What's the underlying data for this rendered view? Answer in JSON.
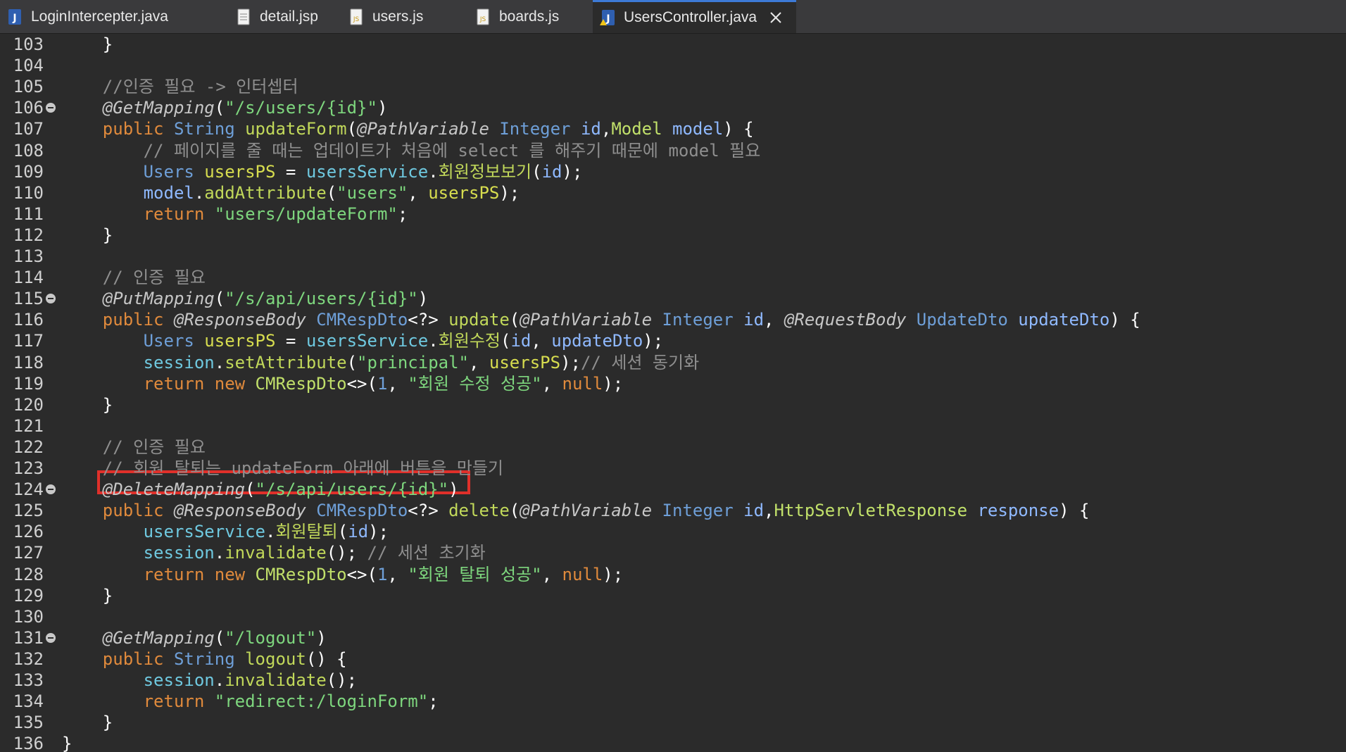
{
  "tabs": [
    {
      "label": "LoginIntercepter.java",
      "icon": "java-file-icon",
      "active": false
    },
    {
      "label": "detail.jsp",
      "icon": "jsp-file-icon",
      "active": false
    },
    {
      "label": "users.js",
      "icon": "js-file-icon",
      "active": false
    },
    {
      "label": "boards.js",
      "icon": "js-file-icon",
      "active": false
    },
    {
      "label": "UsersController.java",
      "icon": "java-file-warning-icon",
      "active": true
    }
  ],
  "colors": {
    "highlight_box": "#e0302a",
    "active_tab_accent": "#3d7ad6",
    "editor_bg": "#2b2b2b"
  },
  "editor": {
    "lines": [
      {
        "n": "103",
        "fold": false,
        "tokens": [
          [
            "plain",
            "    }"
          ]
        ]
      },
      {
        "n": "104",
        "fold": false,
        "tokens": []
      },
      {
        "n": "105",
        "fold": false,
        "tokens": [
          [
            "cm",
            "    //인증 필요 -> 인터셉터"
          ]
        ]
      },
      {
        "n": "106",
        "fold": true,
        "tokens": [
          [
            "ann",
            "    @GetMapping"
          ],
          [
            "plain",
            "("
          ],
          [
            "str",
            "\"/s/users/{id}\""
          ],
          [
            "plain",
            ")"
          ]
        ]
      },
      {
        "n": "107",
        "fold": false,
        "tokens": [
          [
            "kw",
            "    public "
          ],
          [
            "ty",
            "String "
          ],
          [
            "fn",
            "updateForm"
          ],
          [
            "plain",
            "("
          ],
          [
            "ann",
            "@PathVariable "
          ],
          [
            "ty",
            "Integer "
          ],
          [
            "par",
            "id"
          ],
          [
            "plain",
            ","
          ],
          [
            "cls",
            "Model "
          ],
          [
            "par",
            "model"
          ],
          [
            "plain",
            ") {"
          ]
        ]
      },
      {
        "n": "108",
        "fold": false,
        "tokens": [
          [
            "cm",
            "        // 페이지를 줄 때는 업데이트가 처음에 select 를 해주기 때문에 model 필요"
          ]
        ]
      },
      {
        "n": "109",
        "fold": false,
        "tokens": [
          [
            "ty",
            "        Users "
          ],
          [
            "var",
            "usersPS"
          ],
          [
            "plain",
            " = "
          ],
          [
            "fld",
            "usersService"
          ],
          [
            "plain",
            "."
          ],
          [
            "fn",
            "회원정보보기"
          ],
          [
            "plain",
            "("
          ],
          [
            "par",
            "id"
          ],
          [
            "plain",
            ");"
          ]
        ]
      },
      {
        "n": "110",
        "fold": false,
        "tokens": [
          [
            "par",
            "        model"
          ],
          [
            "plain",
            "."
          ],
          [
            "fn",
            "addAttribute"
          ],
          [
            "plain",
            "("
          ],
          [
            "str",
            "\"users\""
          ],
          [
            "plain",
            ", "
          ],
          [
            "var",
            "usersPS"
          ],
          [
            "plain",
            ");"
          ]
        ]
      },
      {
        "n": "111",
        "fold": false,
        "tokens": [
          [
            "kw",
            "        return "
          ],
          [
            "str",
            "\"users/updateForm\""
          ],
          [
            "plain",
            ";"
          ]
        ]
      },
      {
        "n": "112",
        "fold": false,
        "tokens": [
          [
            "plain",
            "    }"
          ]
        ]
      },
      {
        "n": "113",
        "fold": false,
        "tokens": []
      },
      {
        "n": "114",
        "fold": false,
        "tokens": [
          [
            "cm",
            "    // 인증 필요"
          ]
        ]
      },
      {
        "n": "115",
        "fold": true,
        "tokens": [
          [
            "ann",
            "    @PutMapping"
          ],
          [
            "plain",
            "("
          ],
          [
            "str",
            "\"/s/api/users/{id}\""
          ],
          [
            "plain",
            ")"
          ]
        ]
      },
      {
        "n": "116",
        "fold": false,
        "tokens": [
          [
            "kw",
            "    public "
          ],
          [
            "ann",
            "@ResponseBody "
          ],
          [
            "ty",
            "CMRespDto"
          ],
          [
            "plain",
            "<?> "
          ],
          [
            "fn",
            "update"
          ],
          [
            "plain",
            "("
          ],
          [
            "ann",
            "@PathVariable "
          ],
          [
            "ty",
            "Integer "
          ],
          [
            "par",
            "id"
          ],
          [
            "plain",
            ", "
          ],
          [
            "ann",
            "@RequestBody "
          ],
          [
            "ty",
            "UpdateDto "
          ],
          [
            "par",
            "updateDto"
          ],
          [
            "plain",
            ") {"
          ]
        ]
      },
      {
        "n": "117",
        "fold": false,
        "tokens": [
          [
            "ty",
            "        Users "
          ],
          [
            "var",
            "usersPS"
          ],
          [
            "plain",
            " = "
          ],
          [
            "fld",
            "usersService"
          ],
          [
            "plain",
            "."
          ],
          [
            "fn",
            "회원수정"
          ],
          [
            "plain",
            "("
          ],
          [
            "par",
            "id"
          ],
          [
            "plain",
            ", "
          ],
          [
            "par",
            "updateDto"
          ],
          [
            "plain",
            ");"
          ]
        ]
      },
      {
        "n": "118",
        "fold": false,
        "tokens": [
          [
            "fld",
            "        session"
          ],
          [
            "plain",
            "."
          ],
          [
            "fn",
            "setAttribute"
          ],
          [
            "plain",
            "("
          ],
          [
            "str",
            "\"principal\""
          ],
          [
            "plain",
            ", "
          ],
          [
            "var",
            "usersPS"
          ],
          [
            "plain",
            ");"
          ],
          [
            "cm",
            "// 세션 동기화"
          ]
        ]
      },
      {
        "n": "119",
        "fold": false,
        "tokens": [
          [
            "kw",
            "        return new "
          ],
          [
            "cls",
            "CMRespDto"
          ],
          [
            "plain",
            "<>("
          ],
          [
            "num",
            "1"
          ],
          [
            "plain",
            ", "
          ],
          [
            "str",
            "\"회원 수정 성공\""
          ],
          [
            "plain",
            ", "
          ],
          [
            "kw",
            "null"
          ],
          [
            "plain",
            ");"
          ]
        ]
      },
      {
        "n": "120",
        "fold": false,
        "tokens": [
          [
            "plain",
            "    }"
          ]
        ]
      },
      {
        "n": "121",
        "fold": false,
        "tokens": []
      },
      {
        "n": "122",
        "fold": false,
        "tokens": [
          [
            "cm",
            "    // 인증 필요"
          ]
        ]
      },
      {
        "n": "123",
        "fold": false,
        "tokens": [
          [
            "cm",
            "    // 회원 탈퇴는 updateForm 아래에 버튼을 만들기"
          ]
        ]
      },
      {
        "n": "124",
        "fold": true,
        "tokens": [
          [
            "ann",
            "    @DeleteMapping"
          ],
          [
            "plain",
            "("
          ],
          [
            "str",
            "\"/s/api/users/{id}\""
          ],
          [
            "plain",
            ")"
          ]
        ]
      },
      {
        "n": "125",
        "fold": false,
        "tokens": [
          [
            "kw",
            "    public "
          ],
          [
            "ann",
            "@ResponseBody "
          ],
          [
            "ty",
            "CMRespDto"
          ],
          [
            "plain",
            "<?> "
          ],
          [
            "fn",
            "delete"
          ],
          [
            "plain",
            "("
          ],
          [
            "ann",
            "@PathVariable "
          ],
          [
            "ty",
            "Integer "
          ],
          [
            "par",
            "id"
          ],
          [
            "plain",
            ","
          ],
          [
            "cls",
            "HttpServletResponse "
          ],
          [
            "par",
            "response"
          ],
          [
            "plain",
            ") {"
          ]
        ]
      },
      {
        "n": "126",
        "fold": false,
        "tokens": [
          [
            "fld",
            "        usersService"
          ],
          [
            "plain",
            "."
          ],
          [
            "fn",
            "회원탈퇴"
          ],
          [
            "plain",
            "("
          ],
          [
            "par",
            "id"
          ],
          [
            "plain",
            ");"
          ]
        ]
      },
      {
        "n": "127",
        "fold": false,
        "tokens": [
          [
            "fld",
            "        session"
          ],
          [
            "plain",
            "."
          ],
          [
            "fn",
            "invalidate"
          ],
          [
            "plain",
            "(); "
          ],
          [
            "cm",
            "// 세션 초기화"
          ]
        ]
      },
      {
        "n": "128",
        "fold": false,
        "tokens": [
          [
            "kw",
            "        return new "
          ],
          [
            "cls",
            "CMRespDto"
          ],
          [
            "plain",
            "<>("
          ],
          [
            "num",
            "1"
          ],
          [
            "plain",
            ", "
          ],
          [
            "str",
            "\"회원 탈퇴 성공\""
          ],
          [
            "plain",
            ", "
          ],
          [
            "kw",
            "null"
          ],
          [
            "plain",
            ");"
          ]
        ]
      },
      {
        "n": "129",
        "fold": false,
        "tokens": [
          [
            "plain",
            "    }"
          ]
        ]
      },
      {
        "n": "130",
        "fold": false,
        "tokens": []
      },
      {
        "n": "131",
        "fold": true,
        "tokens": [
          [
            "ann",
            "    @GetMapping"
          ],
          [
            "plain",
            "("
          ],
          [
            "str",
            "\"/logout\""
          ],
          [
            "plain",
            ")"
          ]
        ]
      },
      {
        "n": "132",
        "fold": false,
        "tokens": [
          [
            "kw",
            "    public "
          ],
          [
            "ty",
            "String "
          ],
          [
            "fn",
            "logout"
          ],
          [
            "plain",
            "() {"
          ]
        ]
      },
      {
        "n": "133",
        "fold": false,
        "tokens": [
          [
            "fld",
            "        session"
          ],
          [
            "plain",
            "."
          ],
          [
            "fn",
            "invalidate"
          ],
          [
            "plain",
            "();"
          ]
        ]
      },
      {
        "n": "134",
        "fold": false,
        "tokens": [
          [
            "kw",
            "        return "
          ],
          [
            "str",
            "\"redirect:/loginForm\""
          ],
          [
            "plain",
            ";"
          ]
        ]
      },
      {
        "n": "135",
        "fold": false,
        "tokens": [
          [
            "plain",
            "    }"
          ]
        ]
      },
      {
        "n": "136",
        "fold": false,
        "tokens": [
          [
            "plain",
            "}"
          ]
        ]
      }
    ]
  }
}
